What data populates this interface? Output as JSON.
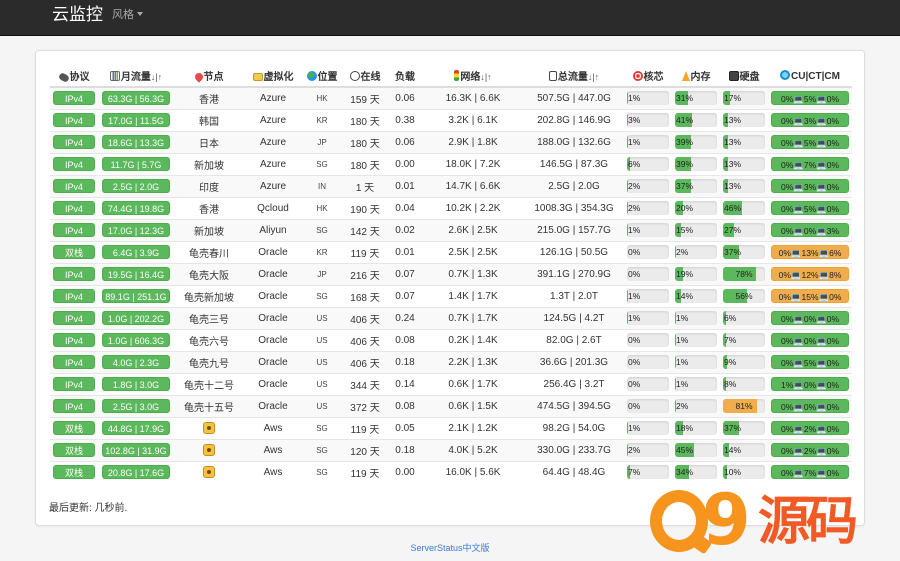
{
  "navbar": {
    "brand": "云监控",
    "style_menu": "风格"
  },
  "columns": {
    "protocol": "协议",
    "monthly_traffic": "月流量",
    "node": "节点",
    "virtualization": "虚拟化",
    "location": "位置",
    "uptime": "在线",
    "load": "负载",
    "network": "网络",
    "total_traffic": "总流量",
    "cpu": "核芯",
    "memory": "内存",
    "disk": "硬盘",
    "cucm": "CU|CT|CM",
    "sort_mark": "↓|↑"
  },
  "rows": [
    {
      "proto": "IPv4",
      "monthly": "63.3G | 56.3G",
      "node": "香港",
      "virt": "Azure",
      "loc": "HK",
      "uptime": "159 天",
      "load": "0.06",
      "net": "16.3K | 6.6K",
      "total": "507.5G | 447.0G",
      "cpu": 1,
      "cpu_text": "1%",
      "mem": 31,
      "mem_text": "31%",
      "disk": 17,
      "disk_text": "17%",
      "cucm": "0%💻5%💻0%"
    },
    {
      "proto": "IPv4",
      "monthly": "17.0G | 11.5G",
      "node": "韩国",
      "virt": "Azure",
      "loc": "KR",
      "uptime": "180 天",
      "load": "0.38",
      "net": "3.2K | 6.1K",
      "total": "202.8G | 146.9G",
      "cpu": 3,
      "cpu_text": "3%",
      "mem": 41,
      "mem_text": "41%",
      "disk": 13,
      "disk_text": "13%",
      "cucm": "0%💻3%💻0%"
    },
    {
      "proto": "IPv4",
      "monthly": "18.6G | 13.3G",
      "node": "日本",
      "virt": "Azure",
      "loc": "JP",
      "uptime": "180 天",
      "load": "0.06",
      "net": "2.9K | 1.8K",
      "total": "188.0G | 132.6G",
      "cpu": 1,
      "cpu_text": "1%",
      "mem": 39,
      "mem_text": "39%",
      "disk": 13,
      "disk_text": "13%",
      "cucm": "0%💻5%💻0%"
    },
    {
      "proto": "IPv4",
      "monthly": "11.7G | 5.7G",
      "node": "新加坡",
      "virt": "Azure",
      "loc": "SG",
      "uptime": "180 天",
      "load": "0.00",
      "net": "18.0K | 7.2K",
      "total": "146.5G | 87.3G",
      "cpu": 6,
      "cpu_text": "6%",
      "mem": 39,
      "mem_text": "39%",
      "disk": 13,
      "disk_text": "13%",
      "cucm": "0%💻7%💻0%"
    },
    {
      "proto": "IPv4",
      "monthly": "2.5G | 2.0G",
      "node": "印度",
      "virt": "Azure",
      "loc": "IN",
      "uptime": "1 天",
      "load": "0.01",
      "net": "14.7K | 6.6K",
      "total": "2.5G | 2.0G",
      "cpu": 2,
      "cpu_text": "2%",
      "mem": 37,
      "mem_text": "37%",
      "disk": 13,
      "disk_text": "13%",
      "cucm": "0%💻3%💻0%"
    },
    {
      "proto": "IPv4",
      "monthly": "74.4G | 19.8G",
      "node": "香港",
      "virt": "Qcloud",
      "loc": "HK",
      "uptime": "190 天",
      "load": "0.04",
      "net": "10.2K | 2.2K",
      "total": "1008.3G | 354.3G",
      "cpu": 2,
      "cpu_text": "2%",
      "mem": 20,
      "mem_text": "20%",
      "disk": 46,
      "disk_text": "46%",
      "cucm": "0%💻5%💻0%"
    },
    {
      "proto": "IPv4",
      "monthly": "17.0G | 12.3G",
      "node": "新加坡",
      "virt": "Aliyun",
      "loc": "SG",
      "uptime": "142 天",
      "load": "0.02",
      "net": "2.6K | 2.5K",
      "total": "215.0G | 157.7G",
      "cpu": 1,
      "cpu_text": "1%",
      "mem": 15,
      "mem_text": "15%",
      "disk": 27,
      "disk_text": "27%",
      "cucm": "0%💻0%💻3%"
    },
    {
      "proto": "双栈",
      "monthly": "6.4G | 3.9G",
      "node": "龟壳春川",
      "virt": "Oracle",
      "loc": "KR",
      "uptime": "119 天",
      "load": "0.01",
      "net": "2.5K | 2.5K",
      "total": "126.1G | 50.5G",
      "cpu": 0,
      "cpu_text": "0%",
      "mem": 2,
      "mem_text": "2%",
      "disk": 37,
      "disk_text": "37%",
      "cucm": "0%💻13%💻6%",
      "cucm_warn": true
    },
    {
      "proto": "IPv4",
      "monthly": "19.5G | 16.4G",
      "node": "龟壳大阪",
      "virt": "Oracle",
      "loc": "JP",
      "uptime": "216 天",
      "load": "0.07",
      "net": "0.7K | 1.3K",
      "total": "391.1G | 270.9G",
      "cpu": 0,
      "cpu_text": "0%",
      "mem": 19,
      "mem_text": "19%",
      "disk": 78,
      "disk_text": "78%",
      "disk_center": true,
      "cucm": "0%💻12%💻8%",
      "cucm_warn": true
    },
    {
      "proto": "IPv4",
      "monthly": "89.1G | 251.1G",
      "node": "龟壳新加坡",
      "virt": "Oracle",
      "loc": "SG",
      "uptime": "168 天",
      "load": "0.07",
      "net": "1.4K | 1.7K",
      "total": "1.3T | 2.0T",
      "cpu": 1,
      "cpu_text": "1%",
      "mem": 14,
      "mem_text": "14%",
      "disk": 56,
      "disk_text": "56%",
      "disk_center": true,
      "cucm": "0%💻15%💻0%",
      "cucm_warn": true
    },
    {
      "proto": "IPv4",
      "monthly": "1.0G | 202.2G",
      "node": "龟壳三号",
      "virt": "Oracle",
      "loc": "US",
      "uptime": "406 天",
      "load": "0.24",
      "net": "0.7K | 1.7K",
      "total": "124.5G | 4.2T",
      "cpu": 1,
      "cpu_text": "1%",
      "mem": 1,
      "mem_text": "1%",
      "disk": 6,
      "disk_text": "6%",
      "cucm": "0%💻0%💻0%"
    },
    {
      "proto": "IPv4",
      "monthly": "1.0G | 606.3G",
      "node": "龟壳六号",
      "virt": "Oracle",
      "loc": "US",
      "uptime": "406 天",
      "load": "0.08",
      "net": "0.2K | 1.4K",
      "total": "82.0G | 2.6T",
      "cpu": 0,
      "cpu_text": "0%",
      "mem": 1,
      "mem_text": "1%",
      "disk": 7,
      "disk_text": "7%",
      "cucm": "0%💻0%💻0%"
    },
    {
      "proto": "IPv4",
      "monthly": "4.0G | 2.3G",
      "node": "龟壳九号",
      "virt": "Oracle",
      "loc": "US",
      "uptime": "406 天",
      "load": "0.18",
      "net": "2.2K | 1.3K",
      "total": "36.6G | 201.3G",
      "cpu": 0,
      "cpu_text": "0%",
      "mem": 1,
      "mem_text": "1%",
      "disk": 9,
      "disk_text": "9%",
      "cucm": "0%💻5%💻0%"
    },
    {
      "proto": "IPv4",
      "monthly": "1.8G | 3.0G",
      "node": "龟壳十二号",
      "virt": "Oracle",
      "loc": "US",
      "uptime": "344 天",
      "load": "0.14",
      "net": "0.6K | 1.7K",
      "total": "256.4G | 3.2T",
      "cpu": 0,
      "cpu_text": "0%",
      "mem": 1,
      "mem_text": "1%",
      "disk": 8,
      "disk_text": "8%",
      "cucm": "1%💻0%💻0%"
    },
    {
      "proto": "IPv4",
      "monthly": "2.5G | 3.0G",
      "node": "龟壳十五号",
      "virt": "Oracle",
      "loc": "US",
      "uptime": "372 天",
      "load": "0.08",
      "net": "0.6K | 1.5K",
      "total": "474.5G | 394.5G",
      "cpu": 0,
      "cpu_text": "0%",
      "mem": 2,
      "mem_text": "2%",
      "disk": 81,
      "disk_text": "81%",
      "disk_center": true,
      "disk_warn": true,
      "cucm": "0%💻0%💻0%"
    },
    {
      "proto": "双栈",
      "monthly": "44.8G | 17.9G",
      "node_icon": "lion-face-icon",
      "virt": "Aws",
      "loc": "SG",
      "uptime": "119 天",
      "load": "0.05",
      "net": "2.1K | 1.2K",
      "total": "98.2G | 54.0G",
      "cpu": 1,
      "cpu_text": "1%",
      "mem": 18,
      "mem_text": "18%",
      "disk": 37,
      "disk_text": "37%",
      "cucm": "0%💻2%💻0%"
    },
    {
      "proto": "双栈",
      "monthly": "102.8G | 31.9G",
      "node_icon": "lion-face-icon",
      "virt": "Aws",
      "loc": "SG",
      "uptime": "120 天",
      "load": "0.18",
      "net": "4.0K | 5.2K",
      "total": "330.0G | 233.7G",
      "cpu": 2,
      "cpu_text": "2%",
      "mem": 45,
      "mem_text": "45%",
      "disk": 14,
      "disk_text": "14%",
      "cucm": "0%💻2%💻0%"
    },
    {
      "proto": "双栈",
      "monthly": "20.8G | 17.6G",
      "node_icon": "lion-face-icon",
      "virt": "Aws",
      "loc": "SG",
      "uptime": "119 天",
      "load": "0.00",
      "net": "16.0K | 5.6K",
      "total": "64.4G | 48.4G",
      "cpu": 7,
      "cpu_text": "7%",
      "mem": 34,
      "mem_text": "34%",
      "disk": 10,
      "disk_text": "10%",
      "cucm": "0%💻7%💻0%"
    }
  ],
  "last_updated": "最后更新: 几秒前.",
  "footer": "ServerStatus中文版",
  "watermark": "Q9源码",
  "colors": {
    "success": "#5cb85c",
    "warning": "#f0ad4e",
    "navbar": "#2b2b2b"
  }
}
